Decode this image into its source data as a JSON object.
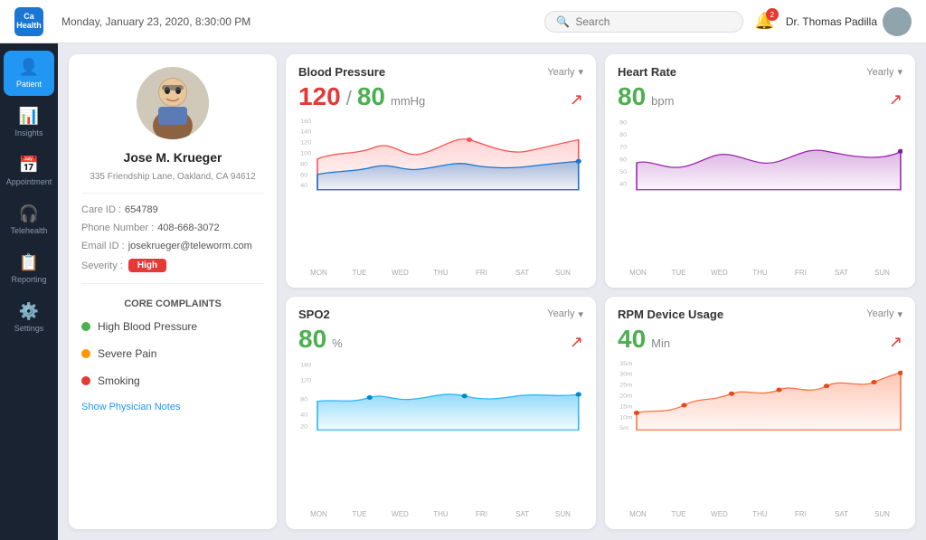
{
  "topbar": {
    "logo_text": "CaHealth",
    "date": "Monday, January 23, 2020, 8:30:00 PM",
    "search_placeholder": "Search",
    "notif_count": "2",
    "user_name": "Dr. Thomas Padilla",
    "yearly_label": "Yearly"
  },
  "sidebar": {
    "items": [
      {
        "label": "Patient",
        "icon": "👤",
        "active": true
      },
      {
        "label": "Insights",
        "icon": "📊",
        "active": false
      },
      {
        "label": "Appointment",
        "icon": "📅",
        "active": false
      },
      {
        "label": "Telehealth",
        "icon": "🎧",
        "active": false
      },
      {
        "label": "Reporting",
        "icon": "📋",
        "active": false
      },
      {
        "label": "Settings",
        "icon": "⚙️",
        "active": false
      }
    ]
  },
  "patient": {
    "name": "Jose M. Krueger",
    "address": "335 Friendship Lane, Oakland, CA 94612",
    "care_id_label": "Care ID :",
    "care_id": "654789",
    "phone_label": "Phone Number :",
    "phone": "408-668-3072",
    "email_label": "Email ID :",
    "email": "josekrueger@teleworm.com",
    "severity_label": "Severity :",
    "severity": "High",
    "core_complaints_title": "CORE COMPLAINTS",
    "complaints": [
      {
        "label": "High Blood Pressure",
        "dot": "green"
      },
      {
        "label": "Severe Pain",
        "dot": "orange"
      },
      {
        "label": "Smoking",
        "dot": "red"
      }
    ],
    "show_notes": "Show Physician Notes"
  },
  "charts": {
    "blood_pressure": {
      "title": "Blood Pressure",
      "value_systolic": "120",
      "value_diastolic": "80",
      "unit": "mmHg",
      "filter": "Yearly",
      "x_labels": [
        "MON",
        "TUE",
        "WED",
        "THU",
        "FRI",
        "SAT",
        "SUN"
      ],
      "y_labels": [
        "160",
        "140",
        "120",
        "100",
        "80",
        "60",
        "40"
      ]
    },
    "heart_rate": {
      "title": "Heart Rate",
      "value": "80",
      "unit": "bpm",
      "filter": "Yearly",
      "x_labels": [
        "MON",
        "TUE",
        "WED",
        "THU",
        "FRI",
        "SAT",
        "SUN"
      ],
      "y_labels": [
        "90",
        "80",
        "70",
        "60",
        "50",
        "40"
      ]
    },
    "spo2": {
      "title": "SPO2",
      "value": "80",
      "unit": "%",
      "filter": "Yearly",
      "x_labels": [
        "MON",
        "TUE",
        "WED",
        "THU",
        "FRI",
        "SAT",
        "SUN"
      ],
      "y_labels": [
        "160",
        "120",
        "80",
        "40",
        "20"
      ]
    },
    "rpm": {
      "title": "RPM Device Usage",
      "value": "40",
      "unit": "Min",
      "filter": "Yearly",
      "x_labels": [
        "MON",
        "TUE",
        "WED",
        "THU",
        "FRI",
        "SAT",
        "SUN"
      ],
      "y_labels": [
        "35m",
        "30m",
        "25m",
        "20m",
        "15m",
        "10m",
        "5m"
      ]
    }
  }
}
